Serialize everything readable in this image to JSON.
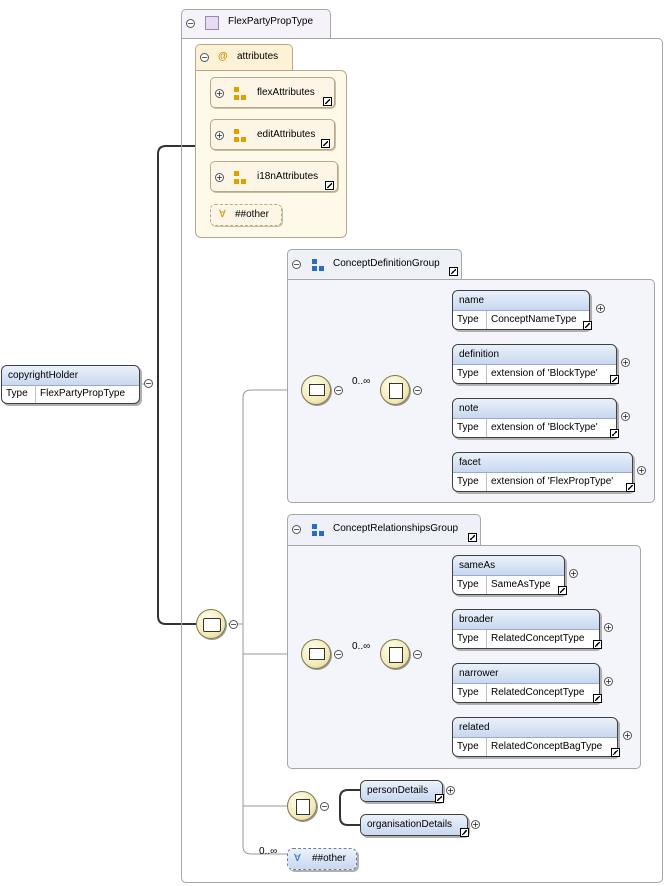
{
  "root": {
    "name": "copyrightHolder",
    "type_label": "Type",
    "type_value": "FlexPartyPropType"
  },
  "complex_type": {
    "name": "FlexPartyPropType"
  },
  "attributes": {
    "title": "attributes",
    "groups": [
      "flexAttributes",
      "editAttributes",
      "i18nAttributes"
    ],
    "any_attribute": "##other"
  },
  "concept_definition_group": {
    "title": "ConceptDefinitionGroup",
    "occurrence": "0..∞",
    "elements": [
      {
        "name": "name",
        "type_label": "Type",
        "type_value": "ConceptNameType"
      },
      {
        "name": "definition",
        "type_label": "Type",
        "type_value": "extension of 'BlockType'"
      },
      {
        "name": "note",
        "type_label": "Type",
        "type_value": "extension of 'BlockType'"
      },
      {
        "name": "facet",
        "type_label": "Type",
        "type_value": "extension of 'FlexPropType'"
      }
    ]
  },
  "concept_relationships_group": {
    "title": "ConceptRelationshipsGroup",
    "occurrence": "0..∞",
    "elements": [
      {
        "name": "sameAs",
        "type_label": "Type",
        "type_value": "SameAsType"
      },
      {
        "name": "broader",
        "type_label": "Type",
        "type_value": "RelatedConceptType"
      },
      {
        "name": "narrower",
        "type_label": "Type",
        "type_value": "RelatedConceptType"
      },
      {
        "name": "related",
        "type_label": "Type",
        "type_value": "RelatedConceptBagType"
      }
    ]
  },
  "choice": {
    "elements": [
      "personDetails",
      "organisationDetails"
    ]
  },
  "any_element": {
    "occurrence": "0..∞",
    "label": "##other"
  },
  "symbols": {
    "collapse": "−",
    "expand": "+",
    "at": "@",
    "any": "∀"
  },
  "colors": {
    "element_header": "#c8d8f0",
    "attribute_bg": "#fdf6e6",
    "group_bg": "#eef1f7",
    "connector": "#333333"
  }
}
